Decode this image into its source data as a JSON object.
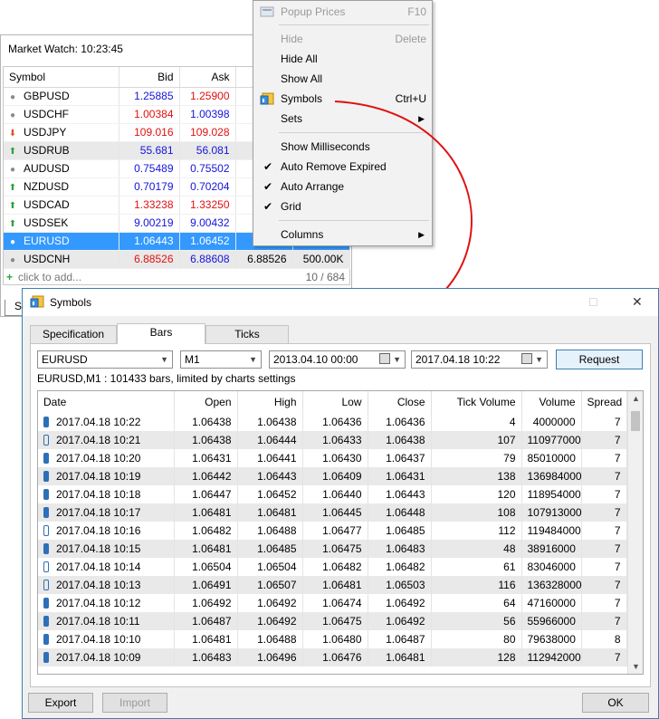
{
  "market_watch": {
    "title": "Market Watch: 10:23:45",
    "columns": [
      "Symbol",
      "Bid",
      "Ask",
      "",
      ""
    ],
    "rows": [
      {
        "icon": "dot",
        "symbol": "GBPUSD",
        "bid": "1.25885",
        "ask": "1.25900",
        "c4": "",
        "c5": "",
        "bid_dir": "up",
        "ask_dir": "dn",
        "state": ""
      },
      {
        "icon": "dot",
        "symbol": "USDCHF",
        "bid": "1.00384",
        "ask": "1.00398",
        "c4": "",
        "c5": "",
        "bid_dir": "dn",
        "ask_dir": "up",
        "state": ""
      },
      {
        "icon": "down",
        "symbol": "USDJPY",
        "bid": "109.016",
        "ask": "109.028",
        "c4": "",
        "c5": "",
        "bid_dir": "dn",
        "ask_dir": "dn",
        "state": ""
      },
      {
        "icon": "up",
        "symbol": "USDRUB",
        "bid": "55.681",
        "ask": "56.081",
        "c4": "",
        "c5": "",
        "bid_dir": "up",
        "ask_dir": "up",
        "state": "gray"
      },
      {
        "icon": "dot",
        "symbol": "AUDUSD",
        "bid": "0.75489",
        "ask": "0.75502",
        "c4": "",
        "c5": "",
        "bid_dir": "up",
        "ask_dir": "up",
        "state": ""
      },
      {
        "icon": "up",
        "symbol": "NZDUSD",
        "bid": "0.70179",
        "ask": "0.70204",
        "c4": "",
        "c5": "",
        "bid_dir": "up",
        "ask_dir": "up",
        "state": ""
      },
      {
        "icon": "up",
        "symbol": "USDCAD",
        "bid": "1.33238",
        "ask": "1.33250",
        "c4": "",
        "c5": "",
        "bid_dir": "dn",
        "ask_dir": "dn",
        "state": ""
      },
      {
        "icon": "up",
        "symbol": "USDSEK",
        "bid": "9.00219",
        "ask": "9.00432",
        "c4": "",
        "c5": "",
        "bid_dir": "up",
        "ask_dir": "up",
        "state": ""
      },
      {
        "icon": "dot",
        "symbol": "EURUSD",
        "bid": "1.06443",
        "ask": "1.06452",
        "c4": "",
        "c5": "",
        "bid_dir": "up",
        "ask_dir": "up",
        "state": "sel"
      },
      {
        "icon": "dot",
        "symbol": "USDCNH",
        "bid": "6.88526",
        "ask": "6.88608",
        "c4": "6.88526",
        "c5": "500.00K",
        "bid_dir": "dn",
        "ask_dir": "up",
        "state": "gray"
      }
    ],
    "add_label": "click to add...",
    "count": "10 / 684",
    "bottom_tab": "Symb"
  },
  "context_menu": {
    "popup_prices": {
      "label": "Popup Prices",
      "shortcut": "F10"
    },
    "hide": {
      "label": "Hide",
      "shortcut": "Delete"
    },
    "hide_all": {
      "label": "Hide All"
    },
    "show_all": {
      "label": "Show All"
    },
    "symbols": {
      "label": "Symbols",
      "shortcut": "Ctrl+U"
    },
    "sets": {
      "label": "Sets"
    },
    "show_ms": {
      "label": "Show Milliseconds"
    },
    "auto_remove": {
      "label": "Auto Remove Expired"
    },
    "auto_arrange": {
      "label": "Auto Arrange"
    },
    "grid": {
      "label": "Grid"
    },
    "columns": {
      "label": "Columns"
    }
  },
  "symbols_dialog": {
    "title": "Symbols",
    "tabs": [
      "Specification",
      "Bars",
      "Ticks"
    ],
    "symbol_value": "EURUSD",
    "timeframe_value": "M1",
    "date_from": "2013.04.10 00:00",
    "date_to": "2017.04.18 10:22",
    "request_label": "Request",
    "info": "EURUSD,M1 : 101433 bars, limited by charts settings",
    "columns": [
      "Date",
      "Open",
      "High",
      "Low",
      "Close",
      "Tick Volume",
      "Volume",
      "Spread"
    ],
    "rows": [
      {
        "bull": true,
        "date": "2017.04.18 10:22",
        "open": "1.06438",
        "high": "1.06438",
        "low": "1.06436",
        "close": "1.06436",
        "tick_volume": "4",
        "volume": "4000000",
        "spread": "7"
      },
      {
        "bull": false,
        "date": "2017.04.18 10:21",
        "open": "1.06438",
        "high": "1.06444",
        "low": "1.06433",
        "close": "1.06438",
        "tick_volume": "107",
        "volume": "110977000",
        "spread": "7"
      },
      {
        "bull": true,
        "date": "2017.04.18 10:20",
        "open": "1.06431",
        "high": "1.06441",
        "low": "1.06430",
        "close": "1.06437",
        "tick_volume": "79",
        "volume": "85010000",
        "spread": "7"
      },
      {
        "bull": true,
        "date": "2017.04.18 10:19",
        "open": "1.06442",
        "high": "1.06443",
        "low": "1.06409",
        "close": "1.06431",
        "tick_volume": "138",
        "volume": "136984000",
        "spread": "7"
      },
      {
        "bull": true,
        "date": "2017.04.18 10:18",
        "open": "1.06447",
        "high": "1.06452",
        "low": "1.06440",
        "close": "1.06443",
        "tick_volume": "120",
        "volume": "118954000",
        "spread": "7"
      },
      {
        "bull": true,
        "date": "2017.04.18 10:17",
        "open": "1.06481",
        "high": "1.06481",
        "low": "1.06445",
        "close": "1.06448",
        "tick_volume": "108",
        "volume": "107913000",
        "spread": "7"
      },
      {
        "bull": false,
        "date": "2017.04.18 10:16",
        "open": "1.06482",
        "high": "1.06488",
        "low": "1.06477",
        "close": "1.06485",
        "tick_volume": "112",
        "volume": "119484000",
        "spread": "7"
      },
      {
        "bull": true,
        "date": "2017.04.18 10:15",
        "open": "1.06481",
        "high": "1.06485",
        "low": "1.06475",
        "close": "1.06483",
        "tick_volume": "48",
        "volume": "38916000",
        "spread": "7"
      },
      {
        "bull": false,
        "date": "2017.04.18 10:14",
        "open": "1.06504",
        "high": "1.06504",
        "low": "1.06482",
        "close": "1.06482",
        "tick_volume": "61",
        "volume": "83046000",
        "spread": "7"
      },
      {
        "bull": false,
        "date": "2017.04.18 10:13",
        "open": "1.06491",
        "high": "1.06507",
        "low": "1.06481",
        "close": "1.06503",
        "tick_volume": "116",
        "volume": "136328000",
        "spread": "7"
      },
      {
        "bull": true,
        "date": "2017.04.18 10:12",
        "open": "1.06492",
        "high": "1.06492",
        "low": "1.06474",
        "close": "1.06492",
        "tick_volume": "64",
        "volume": "47160000",
        "spread": "7"
      },
      {
        "bull": true,
        "date": "2017.04.18 10:11",
        "open": "1.06487",
        "high": "1.06492",
        "low": "1.06475",
        "close": "1.06492",
        "tick_volume": "56",
        "volume": "55966000",
        "spread": "7"
      },
      {
        "bull": true,
        "date": "2017.04.18 10:10",
        "open": "1.06481",
        "high": "1.06488",
        "low": "1.06480",
        "close": "1.06487",
        "tick_volume": "80",
        "volume": "79638000",
        "spread": "8"
      },
      {
        "bull": true,
        "date": "2017.04.18 10:09",
        "open": "1.06483",
        "high": "1.06496",
        "low": "1.06476",
        "close": "1.06481",
        "tick_volume": "128",
        "volume": "112942000",
        "spread": "7"
      }
    ],
    "export_label": "Export",
    "import_label": "Import",
    "ok_label": "OK"
  },
  "colors": {
    "accent": "#3399ff",
    "up": "#1414d8",
    "down": "#e01010",
    "arrow": "#e01010"
  },
  "icons": {
    "maximize": "□",
    "close": "✕"
  }
}
